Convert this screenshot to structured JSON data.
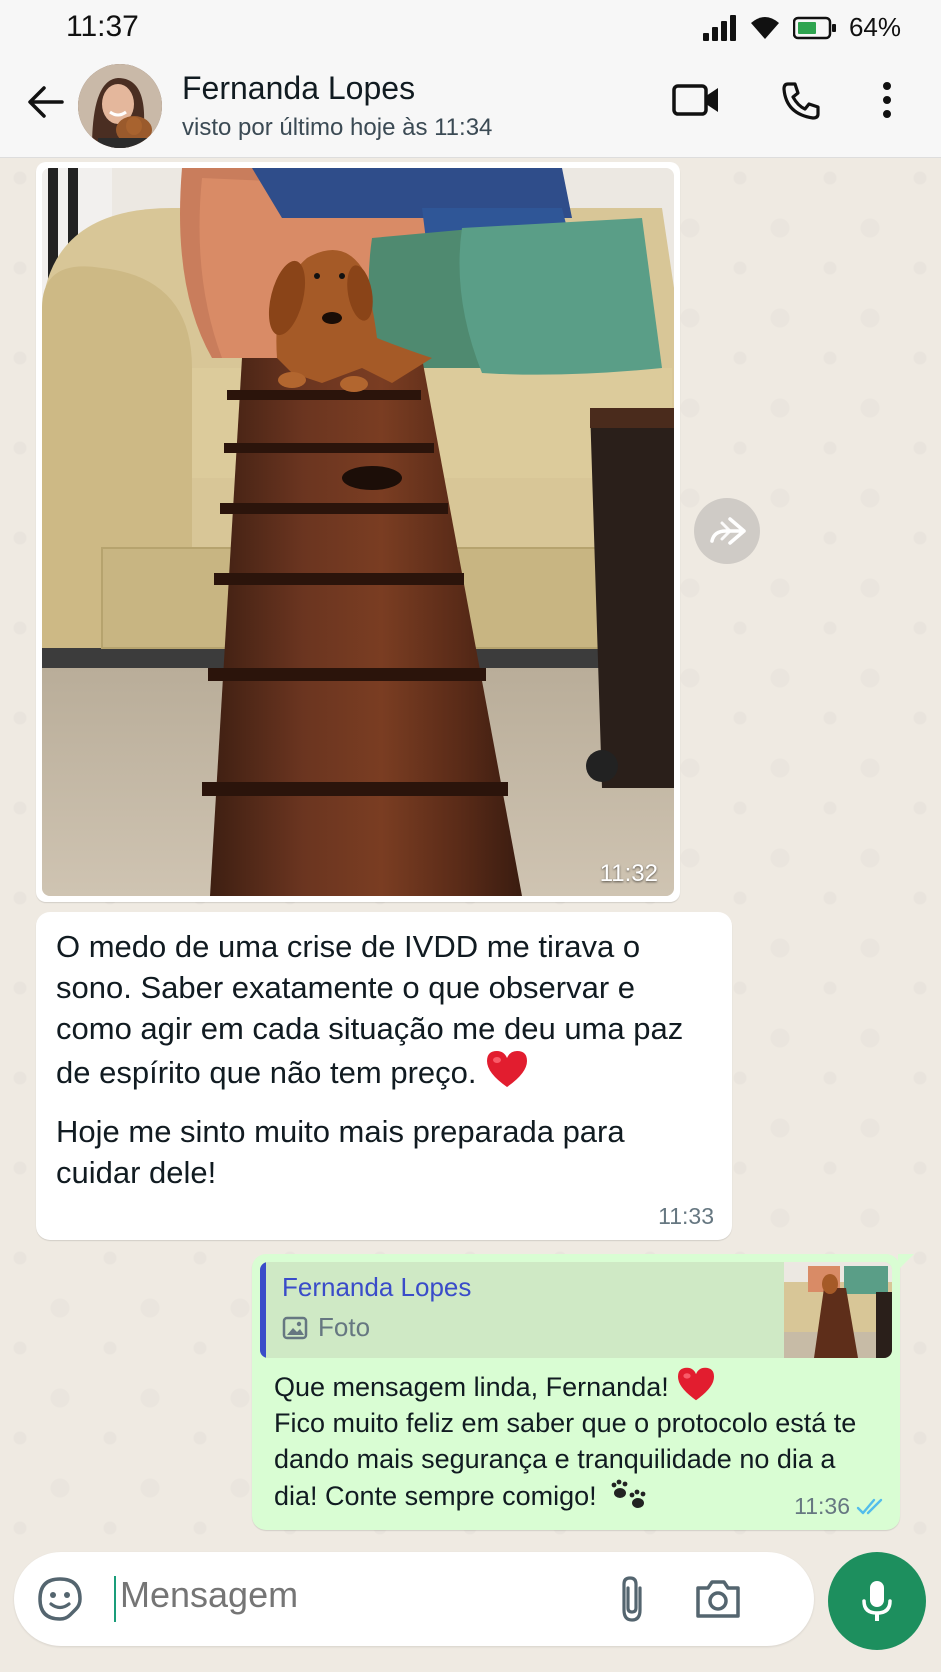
{
  "status_bar": {
    "time": "11:37",
    "battery_percent": "64%",
    "icons": [
      "signal-icon",
      "wifi-icon",
      "battery-icon"
    ]
  },
  "header": {
    "contact_name": "Fernanda Lopes",
    "last_seen": "visto por último hoje às 11:34",
    "icons": [
      "back-arrow-icon",
      "video-call-icon",
      "voice-call-icon",
      "more-vert-icon"
    ]
  },
  "messages": [
    {
      "type": "image",
      "direction": "incoming",
      "time": "11:32"
    },
    {
      "type": "text",
      "direction": "incoming",
      "paragraph1": "O medo de uma crise de IVDD me tirava o sono. Saber exatamente o que observar e como agir em cada situação me deu uma paz de espírito que não tem preço.",
      "paragraph2": "Hoje me sinto muito mais preparada para cuidar dele!",
      "time": "11:33"
    },
    {
      "type": "reply",
      "direction": "outgoing",
      "quoted_name": "Fernanda Lopes",
      "quoted_type": "Foto",
      "line1": "Que mensagem linda, Fernanda!",
      "rest": "Fico muito feliz em saber que o protocolo está te dando mais segurança e tranquilidade no dia a dia! Conte sempre comigo!",
      "time": "11:36",
      "read_status": "read"
    }
  ],
  "composer": {
    "placeholder": "Mensagem"
  },
  "colors": {
    "outgoing_bubble": "#d9fdd3",
    "incoming_bubble": "#ffffff",
    "chat_background": "#efeae2",
    "accent": "#1d8f5e",
    "quote_name": "#3a4cc9",
    "read_ticks": "#53bdeb"
  }
}
